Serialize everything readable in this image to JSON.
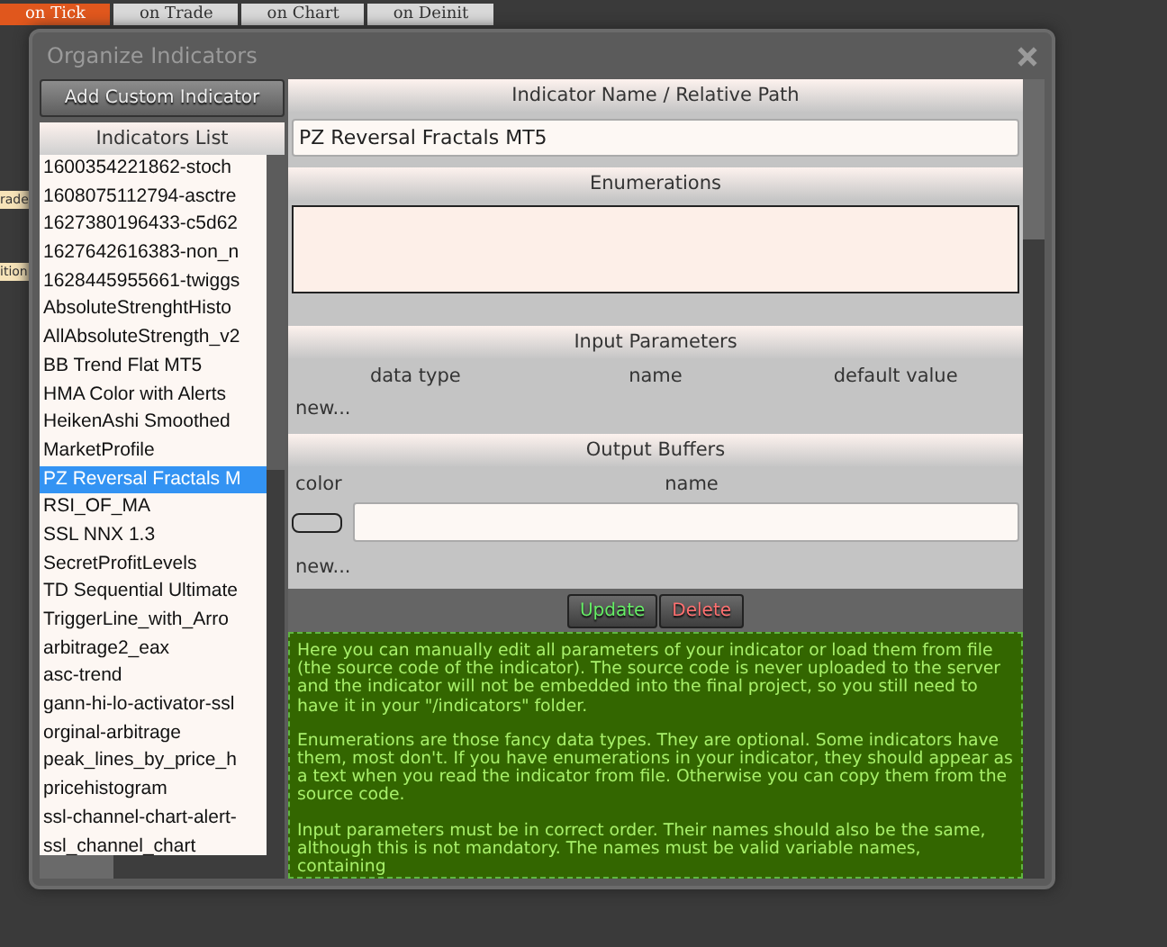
{
  "background_tabs": [
    {
      "label": "on Tick",
      "selected": true
    },
    {
      "label": "on Trade",
      "selected": false
    },
    {
      "label": "on Chart",
      "selected": false
    },
    {
      "label": "on Deinit",
      "selected": false
    }
  ],
  "background_labels": [
    "rade",
    "ition"
  ],
  "dialog": {
    "title": "Organize Indicators",
    "add_button": "Add Custom Indicator",
    "list_header": "Indicators List",
    "indicators": [
      {
        "label": "1600354221862-stoch",
        "selected": false
      },
      {
        "label": "1608075112794-asctre",
        "selected": false
      },
      {
        "label": "1627380196433-c5d62",
        "selected": false
      },
      {
        "label": "1627642616383-non_n",
        "selected": false
      },
      {
        "label": "1628445955661-twiggs",
        "selected": false
      },
      {
        "label": "AbsoluteStrenghtHisto",
        "selected": false
      },
      {
        "label": "AllAbsoluteStrength_v2",
        "selected": false
      },
      {
        "label": "BB Trend Flat MT5",
        "selected": false
      },
      {
        "label": "HMA Color with Alerts",
        "selected": false
      },
      {
        "label": "HeikenAshi Smoothed",
        "selected": false
      },
      {
        "label": "MarketProfile",
        "selected": false
      },
      {
        "label": "PZ Reversal Fractals M",
        "selected": true
      },
      {
        "label": "RSI_OF_MA",
        "selected": false
      },
      {
        "label": "SSL NNX 1.3",
        "selected": false
      },
      {
        "label": "SecretProfitLevels",
        "selected": false
      },
      {
        "label": "TD Sequential Ultimate",
        "selected": false
      },
      {
        "label": "TriggerLine_with_Arro",
        "selected": false
      },
      {
        "label": "arbitrage2_eax",
        "selected": false
      },
      {
        "label": "asc-trend",
        "selected": false
      },
      {
        "label": "gann-hi-lo-activator-ssl",
        "selected": false
      },
      {
        "label": "orginal-arbitrage",
        "selected": false
      },
      {
        "label": "peak_lines_by_price_h",
        "selected": false
      },
      {
        "label": "pricehistogram",
        "selected": false
      },
      {
        "label": "ssl-channel-chart-alert-",
        "selected": false
      },
      {
        "label": "ssl_channel_chart",
        "selected": false
      }
    ],
    "name_section": {
      "header": "Indicator Name / Relative Path",
      "value": "PZ Reversal Fractals MT5"
    },
    "enumerations": {
      "header": "Enumerations"
    },
    "input_parameters": {
      "header": "Input Parameters",
      "columns": [
        "data type",
        "name",
        "default value"
      ],
      "new_link": "new..."
    },
    "output_buffers": {
      "header": "Output Buffers",
      "columns": [
        "color",
        "name"
      ],
      "rows": [
        {
          "kind": "blank"
        }
      ],
      "new_link": "new..."
    },
    "buttons": [
      {
        "label": "Update",
        "kind": "update"
      },
      {
        "label": "Delete",
        "kind": "delete"
      }
    ],
    "help": [
      "Here you can manually edit all parameters of your indicator or load them from file (the source code of the indicator). The source code is never uploaded to the server and the indicator will not be embedded into the final project, so you still need to have it in your \"/indicators\" folder.",
      "Enumerations are those fancy data types. They are optional. Some indicators have them, most don't. If you have enumerations in your indicator, they should appear as a text when you read the indicator from file. Otherwise you can copy them from the source code.",
      "Input parameters must be in correct order. Their names should also be the same, although this is not mandatory. The names must be valid variable names, containing"
    ]
  }
}
